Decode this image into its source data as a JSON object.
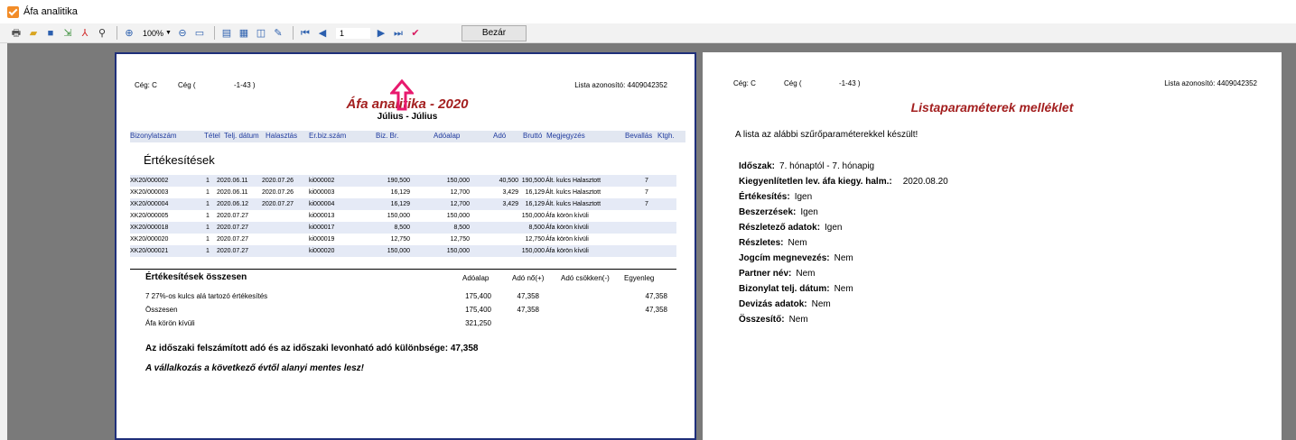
{
  "window": {
    "title": "Áfa analitika"
  },
  "toolbar": {
    "zoom": "100%",
    "page": "1",
    "close_label": "Bezár"
  },
  "report": {
    "company_left": "Cég: C",
    "company_mid": "Cég (",
    "company_code": "-1-43 )",
    "list_id": "Lista azonosító: 4409042352",
    "title": "Áfa analitika - 2020",
    "period": "Július - Július",
    "columns": [
      "Bizonylatszám",
      "Tétel",
      "Telj. dátum",
      "Halasztás",
      "Er.biz.szám",
      "Biz. Br.",
      "Adóalap",
      "Adó",
      "Bruttó",
      "Megjegyzés",
      "Bevallás",
      "Ktgh."
    ],
    "section": "Értékesítések",
    "rows": [
      {
        "doc": "XK20/000002",
        "item": "1",
        "date": "2020.06.11",
        "defer": "2020.07.26",
        "ref": "ki000002",
        "gross_doc": "190,500",
        "base": "150,000",
        "tax": "40,500",
        "gross": "190,500",
        "note": "Ált. kulcs  Halasztott",
        "decl": "7"
      },
      {
        "doc": "XK20/000003",
        "item": "1",
        "date": "2020.06.11",
        "defer": "2020.07.26",
        "ref": "ki000003",
        "gross_doc": "16,129",
        "base": "12,700",
        "tax": "3,429",
        "gross": "16,129",
        "note": "Ált. kulcs  Halasztott",
        "decl": "7"
      },
      {
        "doc": "XK20/000004",
        "item": "1",
        "date": "2020.06.12",
        "defer": "2020.07.27",
        "ref": "ki000004",
        "gross_doc": "16,129",
        "base": "12,700",
        "tax": "3,429",
        "gross": "16,129",
        "note": "Ált. kulcs  Halasztott",
        "decl": "7"
      },
      {
        "doc": "XK20/000005",
        "item": "1",
        "date": "2020.07.27",
        "defer": "",
        "ref": "ki000013",
        "gross_doc": "150,000",
        "base": "150,000",
        "tax": "",
        "gross": "150,000",
        "note": "Áfa körön kívüli",
        "decl": ""
      },
      {
        "doc": "XK20/000018",
        "item": "1",
        "date": "2020.07.27",
        "defer": "",
        "ref": "ki000017",
        "gross_doc": "8,500",
        "base": "8,500",
        "tax": "",
        "gross": "8,500",
        "note": "Áfa körön kívüli",
        "decl": ""
      },
      {
        "doc": "XK20/000020",
        "item": "1",
        "date": "2020.07.27",
        "defer": "",
        "ref": "ki000019",
        "gross_doc": "12,750",
        "base": "12,750",
        "tax": "",
        "gross": "12,750",
        "note": "Áfa körön kívüli",
        "decl": ""
      },
      {
        "doc": "XK20/000021",
        "item": "1",
        "date": "2020.07.27",
        "defer": "",
        "ref": "ki000020",
        "gross_doc": "150,000",
        "base": "150,000",
        "tax": "",
        "gross": "150,000",
        "note": "Áfa körön kívüli",
        "decl": ""
      }
    ],
    "summary": {
      "title": "Értékesítések összesen",
      "headers": [
        "Adóalap",
        "Adó nő(+)",
        "Adó csökken(-)",
        "Egyenleg"
      ],
      "rows": [
        {
          "label": "7 27%-os kulcs alá tartozó értékesítés",
          "base": "175,400",
          "plus": "47,358",
          "minus": "",
          "balance": "47,358"
        },
        {
          "label": "Összesen",
          "base": "175,400",
          "plus": "47,358",
          "minus": "",
          "balance": "47,358"
        },
        {
          "label": "Áfa körön kívüli",
          "base": "321,250",
          "plus": "",
          "minus": "",
          "balance": ""
        }
      ]
    },
    "difference_label": "Az időszaki felszámított adó és az időszaki levonható adó különbsége:",
    "difference_value": "47,358",
    "exempt_note": "A vállalkozás a következő évtől alanyi mentes lesz!"
  },
  "appendix": {
    "company_left": "Cég: C",
    "company_mid": "Cég (",
    "company_code": "-1-43 )",
    "list_id": "Lista azonosító: 4409042352",
    "title": "Listaparaméterek melléklet",
    "intro": "A lista az alábbi szűrőparaméterekkel készült!",
    "params": [
      {
        "label": "Időszak:",
        "value": "7. hónaptól - 7. hónapig"
      },
      {
        "label": "Kiegyenlítetlen lev. áfa kiegy. halm.:",
        "value": "2020.08.20"
      },
      {
        "label": "Értékesítés:",
        "value": "Igen"
      },
      {
        "label": "Beszerzések:",
        "value": "Igen"
      },
      {
        "label": "Részletező adatok:",
        "value": "Igen"
      },
      {
        "label": "Részletes:",
        "value": "Nem"
      },
      {
        "label": "Jogcím megnevezés:",
        "value": "Nem"
      },
      {
        "label": "Partner név:",
        "value": "Nem"
      },
      {
        "label": "Bizonylat telj. dátum:",
        "value": "Nem"
      },
      {
        "label": "Devizás adatok:",
        "value": "Nem"
      },
      {
        "label": "Összesítő:",
        "value": "Nem"
      }
    ]
  },
  "colors": {
    "accent_title": "#a31f1f",
    "header_text": "#1f3a9e",
    "row_alt": "#e5eaf6",
    "marker": "#e8196e",
    "viewer_bg": "#7a7a7a"
  }
}
